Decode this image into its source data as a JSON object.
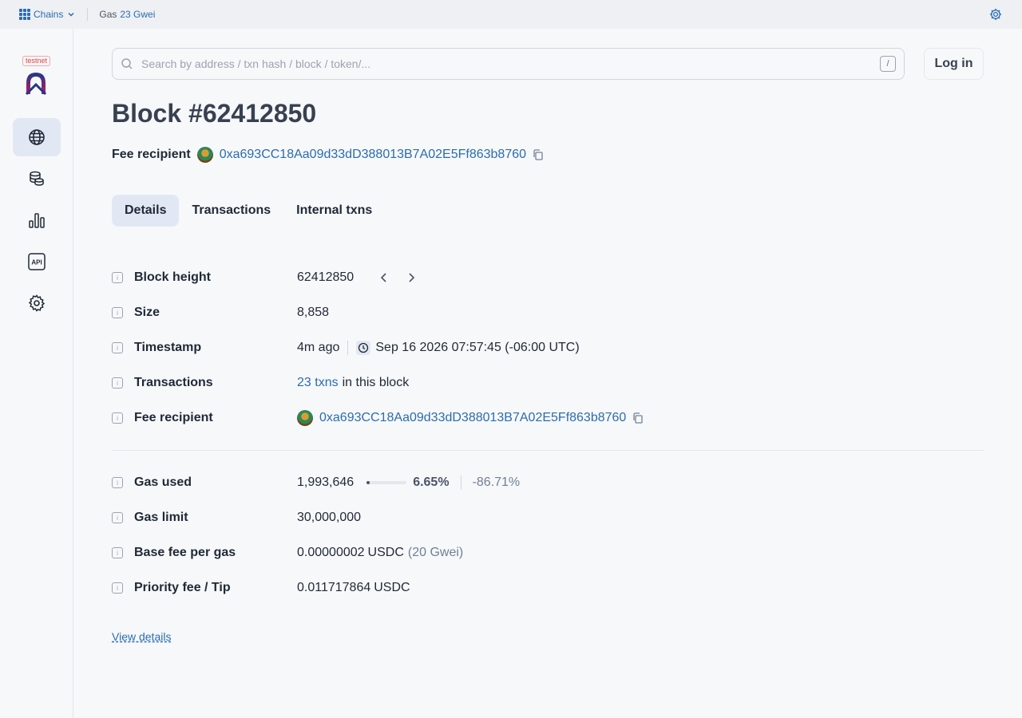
{
  "topbar": {
    "chains_label": "Chains",
    "gas_label": "Gas",
    "gas_value": "23 Gwei"
  },
  "sidebar": {
    "badge": "testnet",
    "items": [
      {
        "icon": "globe-icon",
        "active": true
      },
      {
        "icon": "coins-icon",
        "active": false
      },
      {
        "icon": "chart-icon",
        "active": false
      },
      {
        "icon": "api-icon",
        "active": false
      },
      {
        "icon": "gear-icon",
        "active": false
      }
    ]
  },
  "search": {
    "placeholder": "Search by address / txn hash / block / token/...",
    "shortcut": "/"
  },
  "login_label": "Log in",
  "page": {
    "title": "Block #62412850",
    "fee_recipient_label": "Fee recipient",
    "fee_recipient_address": "0xa693CC18Aa09d33dD388013B7A02E5Ff863b8760"
  },
  "tabs": [
    {
      "label": "Details",
      "active": true
    },
    {
      "label": "Transactions",
      "active": false
    },
    {
      "label": "Internal txns",
      "active": false
    }
  ],
  "details": {
    "block_height": {
      "label": "Block height",
      "value": "62412850"
    },
    "size": {
      "label": "Size",
      "value": "8,858"
    },
    "timestamp": {
      "label": "Timestamp",
      "relative": "4m ago",
      "absolute": "Sep 16 2026 07:57:45 (-06:00 UTC)"
    },
    "transactions": {
      "label": "Transactions",
      "link": "23 txns",
      "suffix": "in this block"
    },
    "fee_recipient": {
      "label": "Fee recipient",
      "value": "0xa693CC18Aa09d33dD388013B7A02E5Ff863b8760"
    },
    "gas_used": {
      "label": "Gas used",
      "value": "1,993,646",
      "percent": "6.65%",
      "percent_fraction": 0.0665,
      "delta": "-86.71%"
    },
    "gas_limit": {
      "label": "Gas limit",
      "value": "30,000,000"
    },
    "base_fee": {
      "label": "Base fee per gas",
      "value": "0.00000002",
      "unit": "USDC",
      "gwei": "(20 Gwei)"
    },
    "priority_fee": {
      "label": "Priority fee / Tip",
      "value": "0.011717864",
      "unit": "USDC"
    }
  },
  "view_details": "View details",
  "colors": {
    "accent": "#2b6cb0",
    "active_bg": "#e2e8f3"
  }
}
